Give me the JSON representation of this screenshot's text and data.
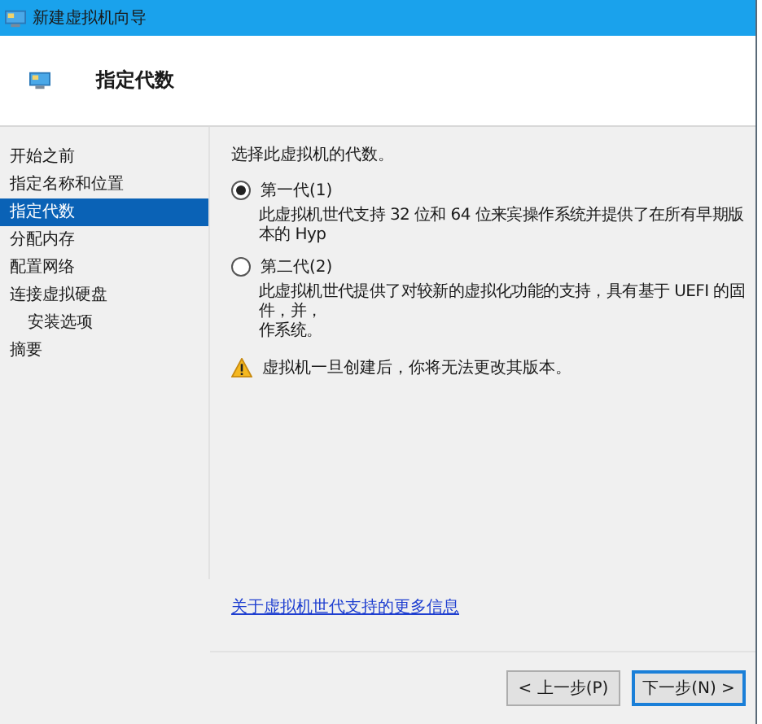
{
  "window": {
    "title": "新建虚拟机向导"
  },
  "header": {
    "title": "指定代数"
  },
  "sidebar": {
    "items": [
      {
        "label": "开始之前",
        "selected": false
      },
      {
        "label": "指定名称和位置",
        "selected": false
      },
      {
        "label": "指定代数",
        "selected": true
      },
      {
        "label": "分配内存",
        "selected": false
      },
      {
        "label": "配置网络",
        "selected": false
      },
      {
        "label": "连接虚拟硬盘",
        "selected": false,
        "children": [
          {
            "label": "安装选项",
            "selected": false
          }
        ]
      },
      {
        "label": "摘要",
        "selected": false
      }
    ]
  },
  "content": {
    "prompt": "选择此虚拟机的代数。",
    "options": [
      {
        "label": "第一代(1)",
        "selected": true,
        "description": [
          "此虚拟机世代支持 32 位和 64 位来宾操作系统并提供了在所有早期版本的 Hyp"
        ]
      },
      {
        "label": "第二代(2)",
        "selected": false,
        "description": [
          "此虚拟机世代提供了对较新的虚拟化功能的支持，具有基于 UEFI 的固件，并，",
          "作系统。"
        ]
      }
    ],
    "warning": "虚拟机一旦创建后，你将无法更改其版本。",
    "link": "关于虚拟机世代支持的更多信息"
  },
  "buttons": [
    {
      "label": "< 上一步(P)",
      "default": false
    },
    {
      "label": "下一步(N) >",
      "default": true
    }
  ]
}
